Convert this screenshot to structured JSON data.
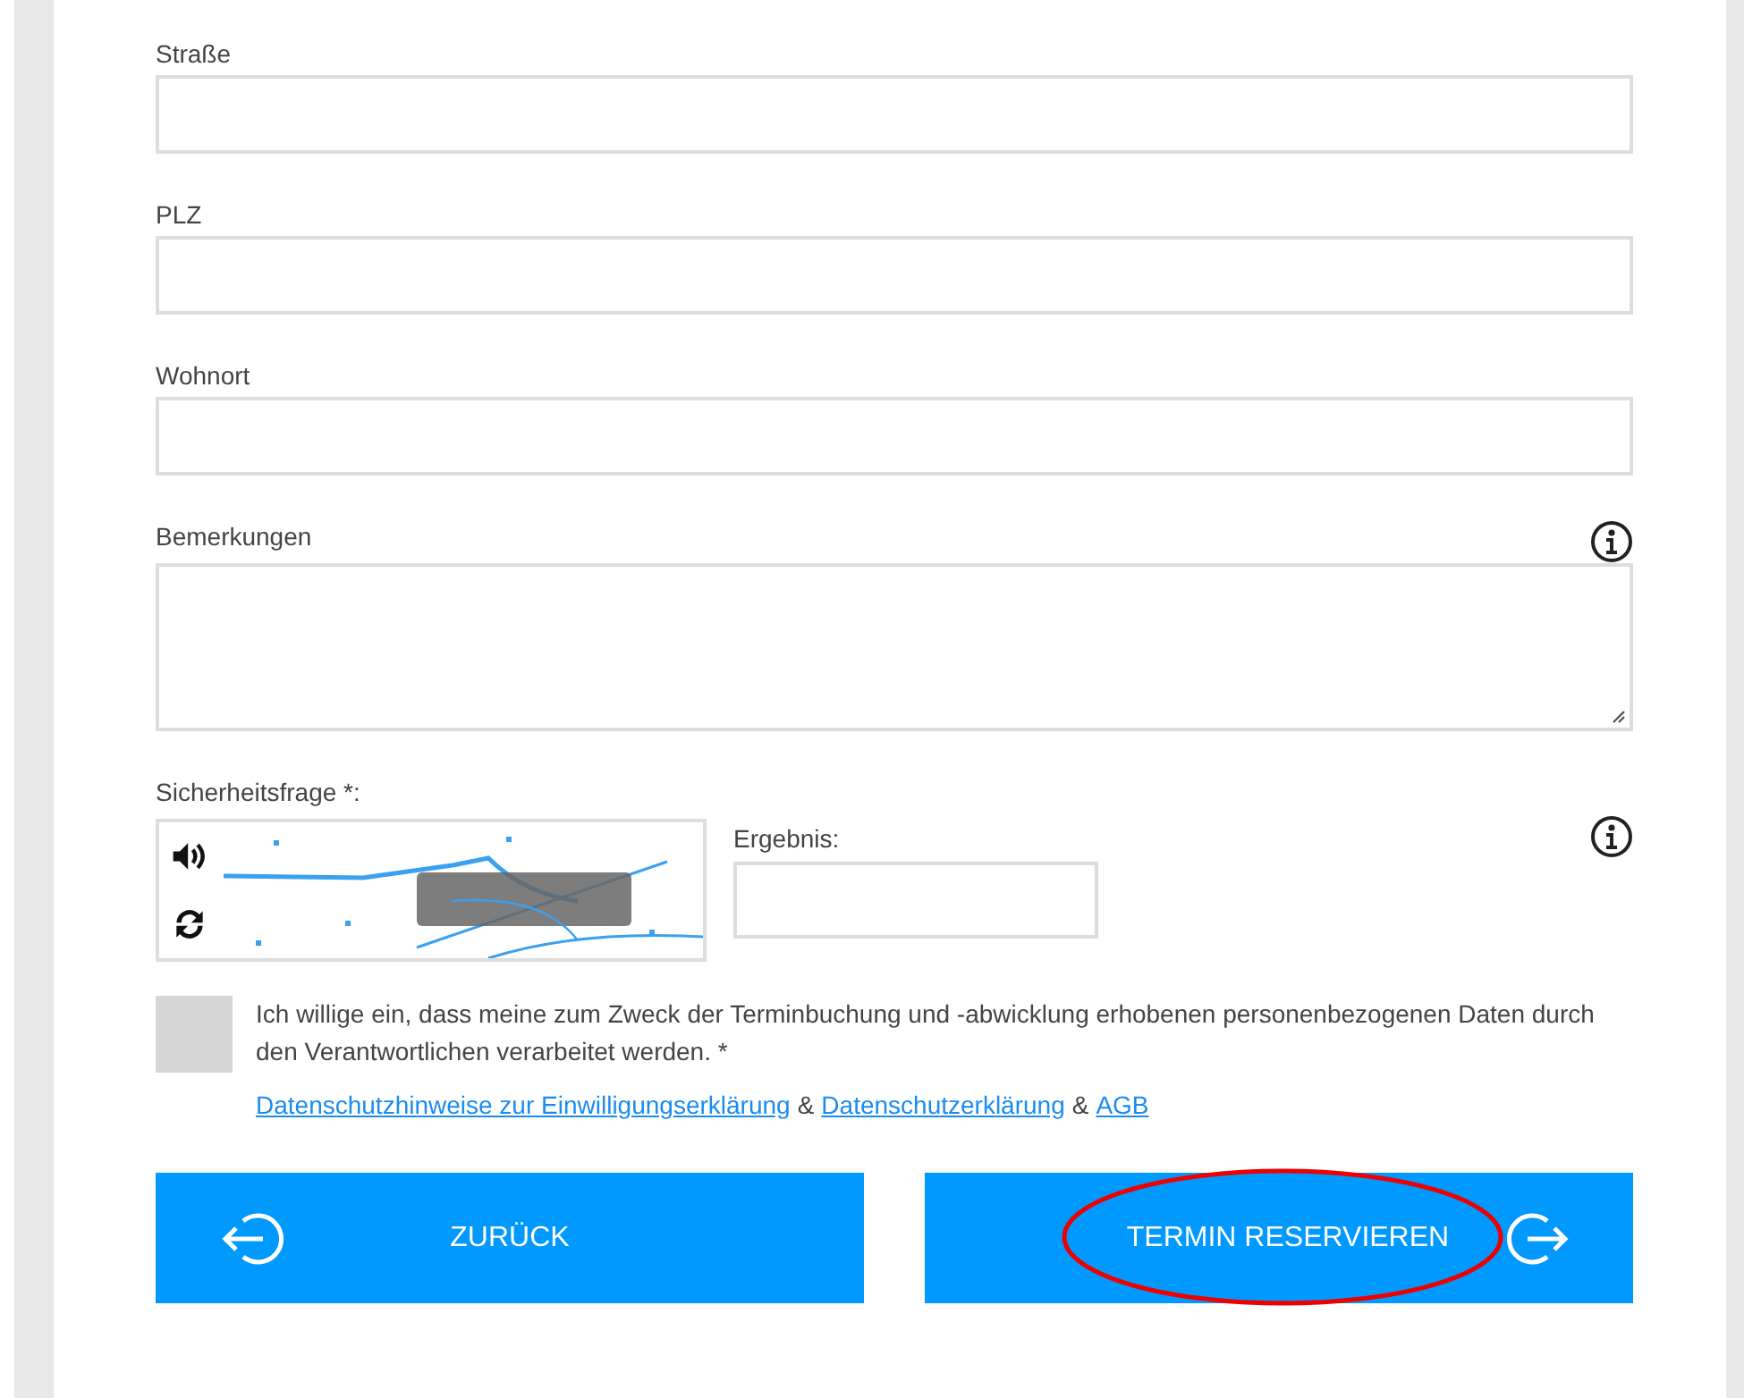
{
  "fields": [
    {
      "label": "Straße"
    },
    {
      "label": "PLZ"
    },
    {
      "label": "Wohnort"
    }
  ],
  "remarks": {
    "label": "Bemerkungen"
  },
  "captcha": {
    "label": "Sicherheitsfrage *:",
    "result_label": "Ergebnis:"
  },
  "consent": {
    "checked": false,
    "text": "Ich willige ein, dass meine zum Zweck der Terminbuchung und -abwicklung erhobenen personenbezogenen Daten durch den Verantwortlichen verarbeitet werden. *",
    "links": [
      {
        "text": "Datenschutzhinweise zur Einwilligungserklärung"
      },
      {
        "text": "&",
        "kind": "sep"
      },
      {
        "text": "Datenschutzerklärung"
      },
      {
        "text": "&",
        "kind": "sep"
      },
      {
        "text": "AGB"
      }
    ]
  },
  "buttons": [
    {
      "label": "ZURÜCK",
      "kind": "back",
      "highlighted": false
    },
    {
      "label": "TERMIN RESERVIEREN",
      "kind": "next",
      "highlighted": true
    }
  ]
}
